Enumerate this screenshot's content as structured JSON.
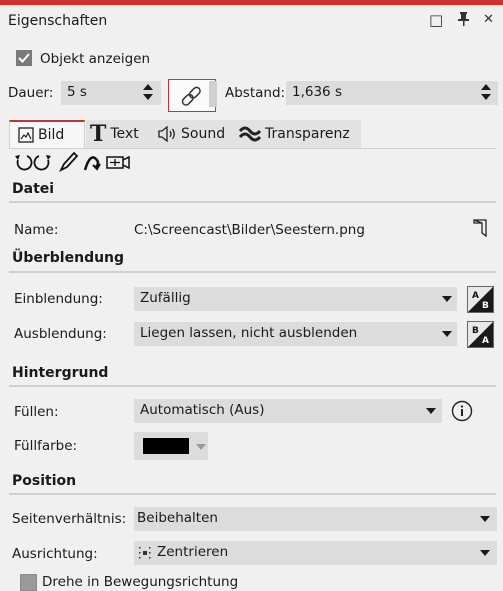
{
  "panel": {
    "title": "Eigenschaften"
  },
  "window_buttons": {
    "maximize_icon": "□",
    "pin_icon": "📌",
    "close_icon": "✕"
  },
  "show_object": {
    "label": "Objekt anzeigen",
    "checked": true
  },
  "duration": {
    "label": "Dauer:",
    "value": "5 s"
  },
  "distance": {
    "label": "Abstand:",
    "value": "1,636 s"
  },
  "tabs": [
    {
      "label": "Bild",
      "icon": "image-icon"
    },
    {
      "label": "Text",
      "icon": "text-icon"
    },
    {
      "label": "Sound",
      "icon": "speaker-icon"
    },
    {
      "label": "Transparenz",
      "icon": "transparency-icon"
    }
  ],
  "toolbar_icons": [
    "rotate-left-icon",
    "rotate-right-icon",
    "pen-icon",
    "path-icon",
    "camera-zoom-icon"
  ],
  "sections": {
    "datei": "Datei",
    "ueberblendung": "Überblendung",
    "hintergrund": "Hintergrund",
    "position": "Position"
  },
  "file": {
    "label": "Name:",
    "value": "C:\\Screencast\\Bilder\\Seestern.png"
  },
  "transition_in": {
    "label": "Einblendung:",
    "value": "Zufällig"
  },
  "transition_out": {
    "label": "Ausblendung:",
    "value": "Liegen lassen, nicht ausblenden"
  },
  "fill": {
    "label": "Füllen:",
    "value": "Automatisch (Aus)"
  },
  "fill_color": {
    "label": "Füllfarbe:",
    "color": "#000000"
  },
  "aspect": {
    "label": "Seitenverhältnis:",
    "value": "Beibehalten"
  },
  "alignment": {
    "label": "Ausrichtung:",
    "value": "Zentrieren"
  },
  "rotate_motion": {
    "label": "Drehe in Bewegungsrichtung",
    "checked": false
  },
  "colors": {
    "accent": "#c8332f",
    "dropdown": "#dcdcdc",
    "background": "#f0f0f0"
  }
}
